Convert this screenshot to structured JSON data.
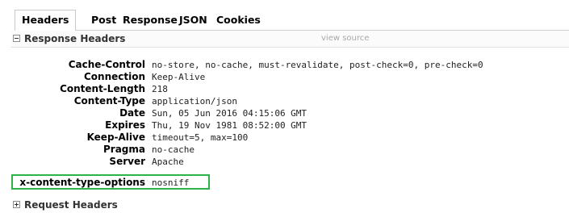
{
  "tabs": [
    "Headers",
    "Post",
    "Response",
    "JSON",
    "Cookies"
  ],
  "response_section": {
    "title": "Response Headers",
    "view_source": "view source"
  },
  "headers": [
    {
      "name": "Cache-Control",
      "value": "no-store, no-cache, must-revalidate, post-check=0, pre-check=0"
    },
    {
      "name": "Connection",
      "value": "Keep-Alive"
    },
    {
      "name": "Content-Length",
      "value": "218"
    },
    {
      "name": "Content-Type",
      "value": "application/json"
    },
    {
      "name": "Date",
      "value": "Sun, 05 Jun 2016 04:15:06 GMT"
    },
    {
      "name": "Expires",
      "value": "Thu, 19 Nov 1981 08:52:00 GMT"
    },
    {
      "name": "Keep-Alive",
      "value": "timeout=5, max=100"
    },
    {
      "name": "Pragma",
      "value": "no-cache"
    },
    {
      "name": "Server",
      "value": "Apache"
    },
    {
      "name": "x-content-type-options",
      "value": "nosniff"
    }
  ],
  "request_section": {
    "title": "Request Headers"
  },
  "highlight_color": "#2eb34a"
}
